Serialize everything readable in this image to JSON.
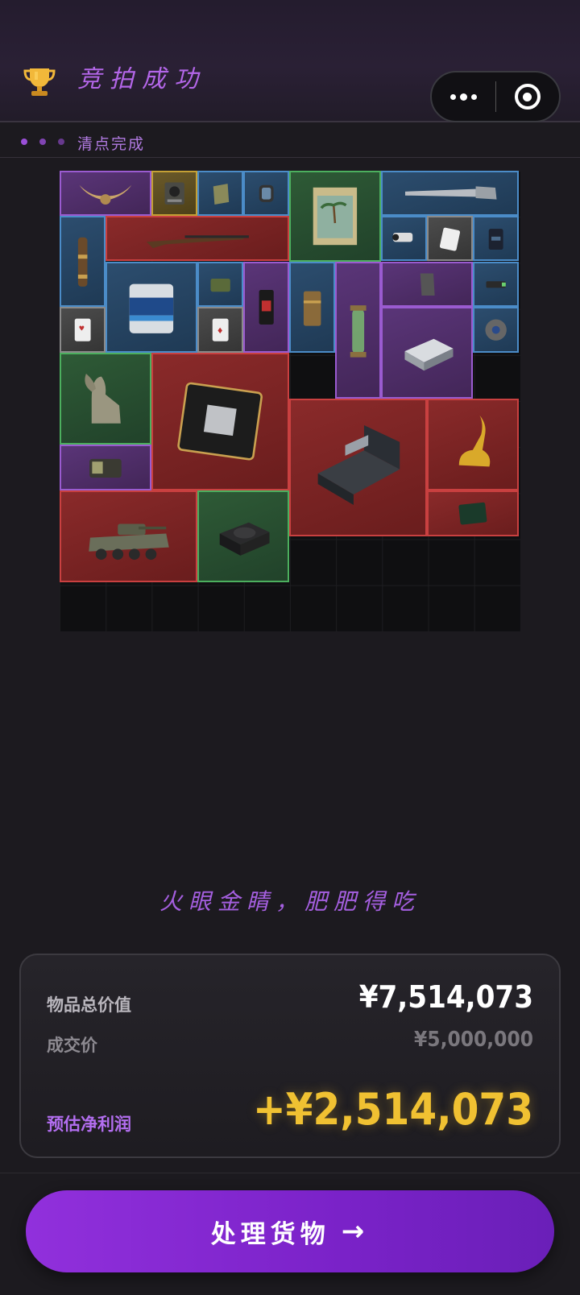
{
  "header": {
    "title": "竞拍成功",
    "icon": "trophy-icon",
    "more_icon": "more-dots-icon",
    "close_icon": "target-close-icon"
  },
  "status": {
    "text": "清点完成"
  },
  "inventory": {
    "items": [
      {
        "name": "horn-amulet",
        "rarity": "purple",
        "icon": "horn-amulet-icon"
      },
      {
        "name": "radio-module",
        "rarity": "gold",
        "icon": "radio-module-icon"
      },
      {
        "name": "cloth-bag",
        "rarity": "blue",
        "icon": "bag-icon"
      },
      {
        "name": "smart-watch",
        "rarity": "blue",
        "icon": "watch-icon"
      },
      {
        "name": "beach-painting",
        "rarity": "green",
        "icon": "painting-icon"
      },
      {
        "name": "hand-saw",
        "rarity": "blue",
        "icon": "saw-icon"
      },
      {
        "name": "telescope",
        "rarity": "blue",
        "icon": "telescope-icon"
      },
      {
        "name": "musket",
        "rarity": "red",
        "icon": "rifle-icon"
      },
      {
        "name": "security-camera",
        "rarity": "blue",
        "icon": "camera-icon"
      },
      {
        "name": "playing-card-chip",
        "rarity": "gray",
        "icon": "card-icon"
      },
      {
        "name": "coffee-bag",
        "rarity": "blue",
        "icon": "coffee-bag-icon"
      },
      {
        "name": "paint-can",
        "rarity": "blue",
        "icon": "paint-can-icon"
      },
      {
        "name": "ammo-tin",
        "rarity": "blue",
        "icon": "tin-icon"
      },
      {
        "name": "snack-pack",
        "rarity": "purple",
        "icon": "snack-icon"
      },
      {
        "name": "ammo-box",
        "rarity": "blue",
        "icon": "ammo-icon"
      },
      {
        "name": "lantern",
        "rarity": "purple",
        "icon": "lantern-icon"
      },
      {
        "name": "stone-tablet",
        "rarity": "purple",
        "icon": "tablet-icon"
      },
      {
        "name": "usb-drive",
        "rarity": "blue",
        "icon": "usb-icon"
      },
      {
        "name": "heart-card",
        "rarity": "gray",
        "icon": "card-icon"
      },
      {
        "name": "diamond-card",
        "rarity": "gray",
        "icon": "card-icon"
      },
      {
        "name": "network-router",
        "rarity": "purple",
        "icon": "router-icon"
      },
      {
        "name": "sensor-disc",
        "rarity": "blue",
        "icon": "disc-icon"
      },
      {
        "name": "sphinx-statue",
        "rarity": "green",
        "icon": "sphinx-icon"
      },
      {
        "name": "cpu-chip",
        "rarity": "red",
        "icon": "cpu-icon"
      },
      {
        "name": "equipment-case",
        "rarity": "red",
        "icon": "case-icon"
      },
      {
        "name": "golden-deer",
        "rarity": "red",
        "icon": "deer-icon"
      },
      {
        "name": "pocket-radio",
        "rarity": "purple",
        "icon": "radio-icon"
      },
      {
        "name": "armored-vehicle",
        "rarity": "red",
        "icon": "tank-icon"
      },
      {
        "name": "power-supply",
        "rarity": "green",
        "icon": "psu-icon"
      },
      {
        "name": "tablet-device",
        "rarity": "red",
        "icon": "tablet-device-icon"
      }
    ]
  },
  "slogan": "火眼金睛，肥肥得吃",
  "summary": {
    "total_label": "物品总价值",
    "total_value": "¥7,514,073",
    "deal_label": "成交价",
    "deal_value": "¥5,000,000",
    "profit_label": "预估净利润",
    "profit_value": "+¥2,514,073"
  },
  "cta": {
    "label": "处理货物",
    "arrow": "→"
  },
  "colors": {
    "accent": "#9a4fd8",
    "profit": "#f0c132",
    "background": "#1c1a1f"
  }
}
